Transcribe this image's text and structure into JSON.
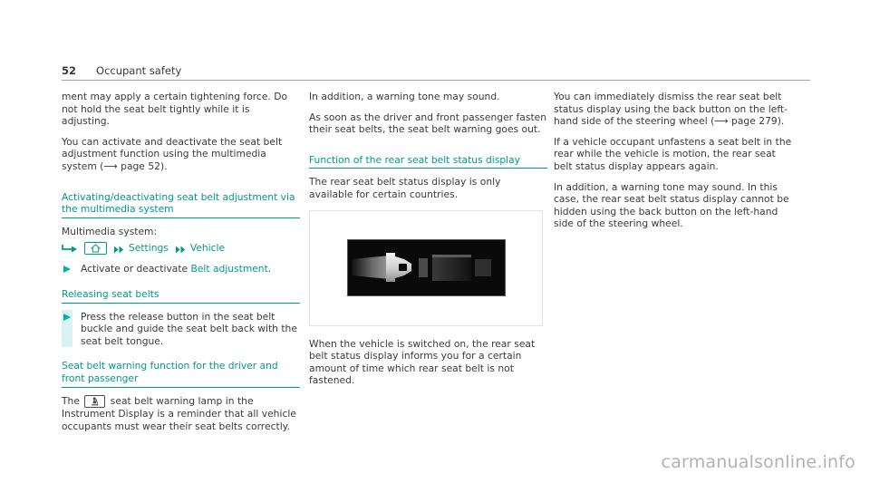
{
  "header": {
    "page_number": "52",
    "section_title": "Occupant safety"
  },
  "columns": {
    "left": {
      "para_1": "ment may apply a certain tightening force. Do not hold the seat belt tightly while it is adjusting.",
      "para_2_a": "You can activate and deactivate the seat belt adjustment function using the multimedia system (",
      "para_2_ref": "⟶ page 52",
      "para_2_b": ").",
      "heading_1": "Activating/deactivating seat belt adjustment via the multimedia system",
      "multimedia_label": "Multimedia system:",
      "path": {
        "enter_icon": "bent-arrow-icon",
        "home_icon": "home-icon",
        "step_1": "Settings",
        "step_2": "Vehicle",
        "separator_icon": "double-arrow-icon"
      },
      "step_1_a": "Activate or deactivate ",
      "step_1_link": "Belt adjustment",
      "step_1_b": ".",
      "heading_2": "Releasing seat belts",
      "step_2_text": "Press the release button in the seat belt buckle and guide the seat belt back with the seat belt tongue.",
      "heading_3": "Seat belt warning function for the driver and front passenger",
      "para_3_a": "The ",
      "para_3_icon": "seat-belt-warning-lamp-icon",
      "para_3_b": " seat belt warning lamp in the Instrument Display is a reminder that all vehicle occupants must wear their seat belts correctly."
    },
    "middle": {
      "para_1": "In addition, a warning tone may sound.",
      "para_2": "As soon as the driver and front passenger fasten their seat belts, the seat belt warning goes out.",
      "heading_1": "Function of the rear seat belt status display",
      "para_3": "The rear seat belt status display is only available for certain countries.",
      "figure_alt": "rear-seat-belt-status-display-image",
      "para_4": "When the vehicle is switched on, the rear seat belt status display informs you for a certain amount of time which rear seat belt is not fastened."
    },
    "right": {
      "para_1_a": "You can immediately dismiss the rear seat belt status display using the back button on the left-hand side of the steering wheel (",
      "para_1_ref": "⟶ page 279",
      "para_1_b": ").",
      "para_2": "If a vehicle occupant unfastens a seat belt in the rear while the vehicle is motion, the rear seat belt status display appears again.",
      "para_3": "In addition, a warning tone may sound. In this case, the rear seat belt status display cannot be hidden using the back button on the left-hand side of the steering wheel."
    }
  },
  "watermark": "carmanualsonline.info",
  "colors": {
    "teal": "#00998e",
    "teal_bright": "#00b2a6",
    "band": "#d9f3f2",
    "text": "#3a3a3a",
    "rule": "#9fa4a6",
    "watermark": "#b2b2b2"
  }
}
